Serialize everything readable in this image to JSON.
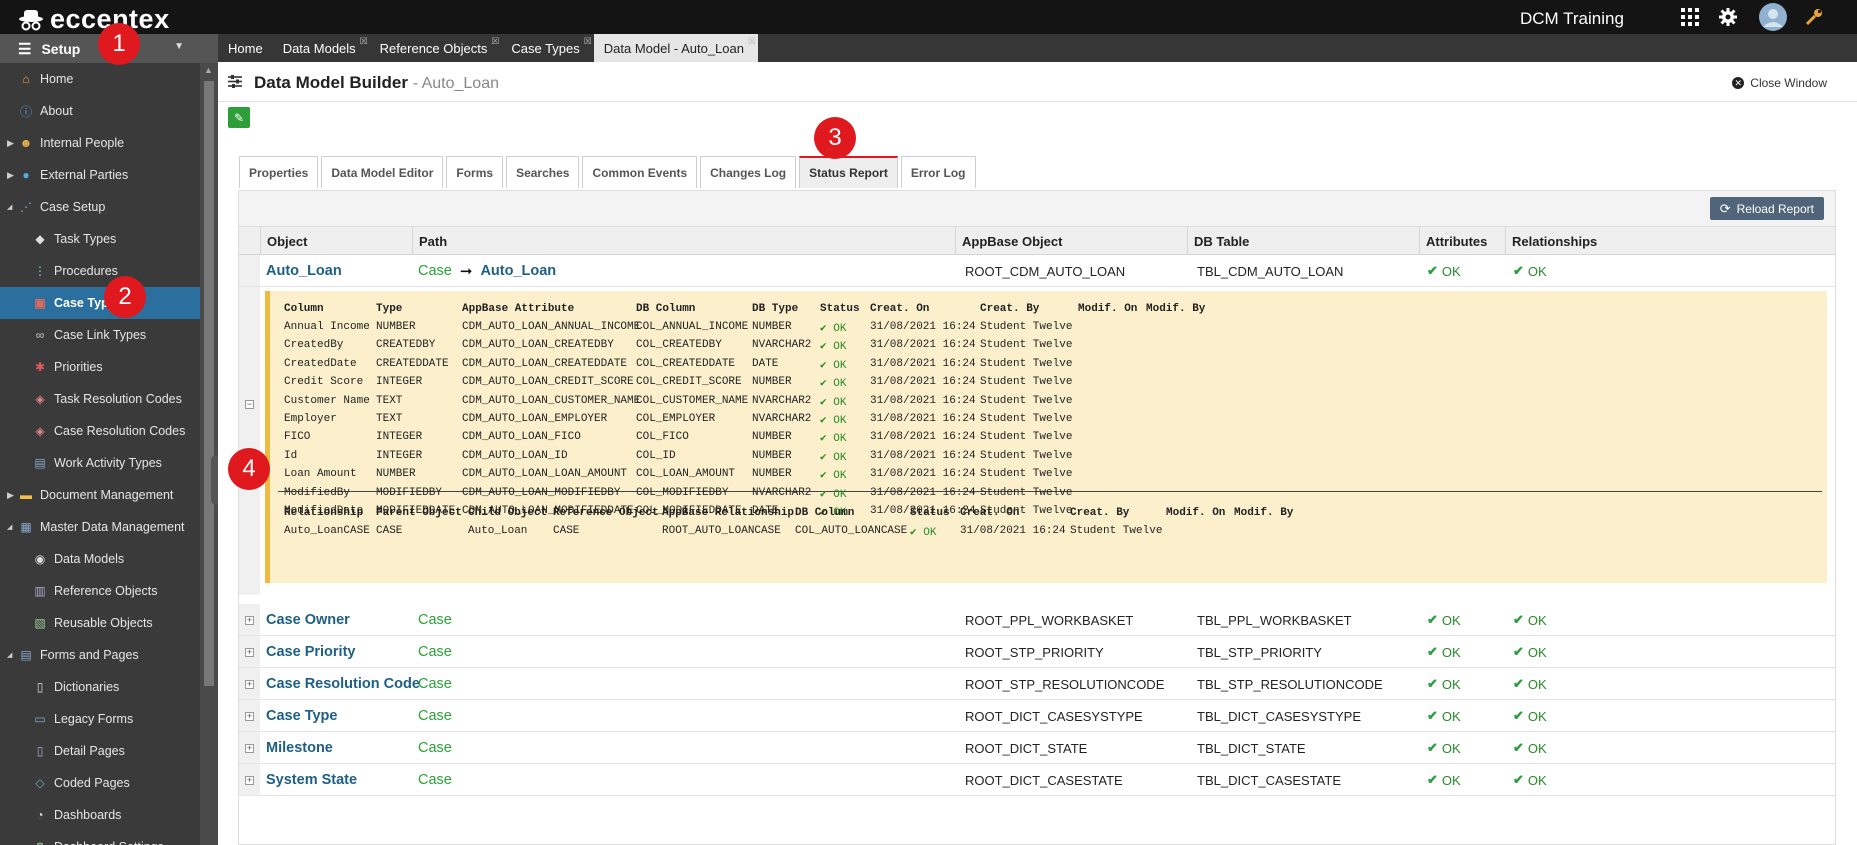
{
  "app": {
    "brand": "eccentex",
    "title": "DCM Training"
  },
  "sidebar": {
    "setup_label": "Setup",
    "items": [
      {
        "label": "Home",
        "icon": "home-icon",
        "indent": 1
      },
      {
        "label": "About",
        "icon": "info-icon",
        "indent": 1
      },
      {
        "label": "Internal People",
        "icon": "people-icon",
        "indent": 1,
        "arrow": true
      },
      {
        "label": "External Parties",
        "icon": "globe-icon",
        "indent": 1,
        "arrow": true
      },
      {
        "label": "Case Setup",
        "icon": "case-setup-icon",
        "indent": 1,
        "open": true
      },
      {
        "label": "Task Types",
        "icon": "cube-icon",
        "indent": 2
      },
      {
        "label": "Procedures",
        "icon": "procedure-icon",
        "indent": 2
      },
      {
        "label": "Case Types",
        "icon": "briefcase-icon",
        "indent": 2,
        "active": true
      },
      {
        "label": "Case Link Types",
        "icon": "link-icon",
        "indent": 2
      },
      {
        "label": "Priorities",
        "icon": "priority-icon",
        "indent": 2
      },
      {
        "label": "Task Resolution Codes",
        "icon": "tag-icon",
        "indent": 2
      },
      {
        "label": "Case Resolution Codes",
        "icon": "tag-icon",
        "indent": 2
      },
      {
        "label": "Work Activity Types",
        "icon": "activity-icon",
        "indent": 2
      },
      {
        "label": "Document Management",
        "icon": "folder-icon",
        "indent": 1,
        "arrow": true
      },
      {
        "label": "Master Data Management",
        "icon": "grid-icon",
        "indent": 1,
        "open": true
      },
      {
        "label": "Data Models",
        "icon": "database-icon",
        "indent": 2
      },
      {
        "label": "Reference Objects",
        "icon": "reference-icon",
        "indent": 2
      },
      {
        "label": "Reusable Objects",
        "icon": "reusable-icon",
        "indent": 2
      },
      {
        "label": "Forms and Pages",
        "icon": "forms-icon",
        "indent": 1,
        "open": true
      },
      {
        "label": "Dictionaries",
        "icon": "dictionary-icon",
        "indent": 2
      },
      {
        "label": "Legacy Forms",
        "icon": "form-icon",
        "indent": 2
      },
      {
        "label": "Detail Pages",
        "icon": "pages-icon",
        "indent": 2
      },
      {
        "label": "Coded Pages",
        "icon": "code-icon",
        "indent": 2
      },
      {
        "label": "Dashboards",
        "icon": "dashboard-icon",
        "indent": 2
      },
      {
        "label": "Dashboard Settings",
        "icon": "settings-icon",
        "indent": 2
      }
    ]
  },
  "open_tabs": [
    {
      "label": "Home",
      "closable": false
    },
    {
      "label": "Data Models",
      "closable": true
    },
    {
      "label": "Reference Objects",
      "closable": true
    },
    {
      "label": "Case Types",
      "closable": true
    },
    {
      "label": "Data Model - Auto_Loan",
      "closable": true,
      "active": true
    }
  ],
  "header": {
    "title": "Data Model Builder",
    "subtitle": "- Auto_Loan",
    "close_label": "Close Window"
  },
  "page_tabs": [
    {
      "label": "Properties"
    },
    {
      "label": "Data Model Editor"
    },
    {
      "label": "Forms"
    },
    {
      "label": "Searches"
    },
    {
      "label": "Common Events"
    },
    {
      "label": "Changes Log"
    },
    {
      "label": "Status Report",
      "active": true
    },
    {
      "label": "Error Log"
    }
  ],
  "reload_label": "Reload Report",
  "columns": [
    "Object",
    "Path",
    "AppBase Object",
    "DB Table",
    "Attributes",
    "Relationships"
  ],
  "ok_label": "OK",
  "expanded": {
    "object": "Auto_Loan",
    "path_parent": "Case",
    "path_child": "Auto_Loan",
    "appbase": "ROOT_CDM_AUTO_LOAN",
    "db_table": "TBL_CDM_AUTO_LOAN"
  },
  "attr_headers": [
    "Column",
    "Type",
    "AppBase Attribute",
    "DB Column",
    "DB Type",
    "Status",
    "Creat. On",
    "Creat. By",
    "Modif. On",
    "Modif. By"
  ],
  "attributes": [
    [
      "Annual Income",
      "NUMBER",
      "CDM_AUTO_LOAN_ANNUAL_INCOME",
      "COL_ANNUAL_INCOME",
      "NUMBER",
      "OK",
      "31/08/2021 16:24",
      "Student Twelve"
    ],
    [
      "CreatedBy",
      "CREATEDBY",
      "CDM_AUTO_LOAN_CREATEDBY",
      "COL_CREATEDBY",
      "NVARCHAR2",
      "OK",
      "31/08/2021 16:24",
      "Student Twelve"
    ],
    [
      "CreatedDate",
      "CREATEDDATE",
      "CDM_AUTO_LOAN_CREATEDDATE",
      "COL_CREATEDDATE",
      "DATE",
      "OK",
      "31/08/2021 16:24",
      "Student Twelve"
    ],
    [
      "Credit Score",
      "INTEGER",
      "CDM_AUTO_LOAN_CREDIT_SCORE",
      "COL_CREDIT_SCORE",
      "NUMBER",
      "OK",
      "31/08/2021 16:24",
      "Student Twelve"
    ],
    [
      "Customer Name",
      "TEXT",
      "CDM_AUTO_LOAN_CUSTOMER_NAME",
      "COL_CUSTOMER_NAME",
      "NVARCHAR2",
      "OK",
      "31/08/2021 16:24",
      "Student Twelve"
    ],
    [
      "Employer",
      "TEXT",
      "CDM_AUTO_LOAN_EMPLOYER",
      "COL_EMPLOYER",
      "NVARCHAR2",
      "OK",
      "31/08/2021 16:24",
      "Student Twelve"
    ],
    [
      "FICO",
      "INTEGER",
      "CDM_AUTO_LOAN_FICO",
      "COL_FICO",
      "NUMBER",
      "OK",
      "31/08/2021 16:24",
      "Student Twelve"
    ],
    [
      "Id",
      "INTEGER",
      "CDM_AUTO_LOAN_ID",
      "COL_ID",
      "NUMBER",
      "OK",
      "31/08/2021 16:24",
      "Student Twelve"
    ],
    [
      "Loan Amount",
      "NUMBER",
      "CDM_AUTO_LOAN_LOAN_AMOUNT",
      "COL_LOAN_AMOUNT",
      "NUMBER",
      "OK",
      "31/08/2021 16:24",
      "Student Twelve"
    ],
    [
      "ModifiedBy",
      "MODIFIEDBY",
      "CDM_AUTO_LOAN_MODIFIEDBY",
      "COL_MODIFIEDBY",
      "NVARCHAR2",
      "OK",
      "31/08/2021 16:24",
      "Student Twelve"
    ],
    [
      "ModifiedDate",
      "MODIFIEDDATE",
      "CDM_AUTO_LOAN_MODIFIEDDATE",
      "COL_MODIFIEDDATE",
      "DATE",
      "OK",
      "31/08/2021 16:24",
      "Student Twelve"
    ]
  ],
  "rel_headers": [
    "Relationship",
    "Parent Object",
    "Child Object",
    "Reference Object",
    "AppBase Relationship",
    "DB Column",
    "Status",
    "Creat. On",
    "Creat. By",
    "Modif. On",
    "Modif. By"
  ],
  "relationships": [
    [
      "Auto_LoanCASE",
      "CASE",
      "Auto_Loan",
      "CASE",
      "ROOT_AUTO_LOANCASE",
      "COL_AUTO_LOANCASE",
      "OK",
      "31/08/2021 16:24",
      "Student Twelve"
    ]
  ],
  "rows": [
    {
      "object": "Case Owner",
      "path": "Case",
      "appbase": "ROOT_PPL_WORKBASKET",
      "db_table": "TBL_PPL_WORKBASKET"
    },
    {
      "object": "Case Priority",
      "path": "Case",
      "appbase": "ROOT_STP_PRIORITY",
      "db_table": "TBL_STP_PRIORITY"
    },
    {
      "object": "Case Resolution Code",
      "path": "Case",
      "appbase": "ROOT_STP_RESOLUTIONCODE",
      "db_table": "TBL_STP_RESOLUTIONCODE"
    },
    {
      "object": "Case Type",
      "path": "Case",
      "appbase": "ROOT_DICT_CASESYSTYPE",
      "db_table": "TBL_DICT_CASESYSTYPE"
    },
    {
      "object": "Milestone",
      "path": "Case",
      "appbase": "ROOT_DICT_STATE",
      "db_table": "TBL_DICT_STATE"
    },
    {
      "object": "System State",
      "path": "Case",
      "appbase": "ROOT_DICT_CASESTATE",
      "db_table": "TBL_DICT_CASESTATE"
    }
  ],
  "badges": [
    "1",
    "2",
    "3",
    "4"
  ],
  "colors": {
    "accent": "#2b6f9e",
    "ok": "#2aa23a",
    "badge": "#e0191e",
    "detail_bg": "#fcf0cc"
  }
}
